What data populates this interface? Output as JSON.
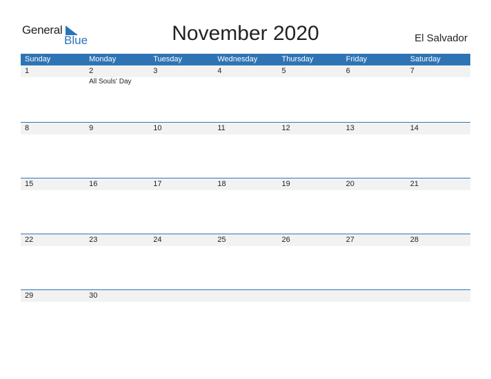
{
  "logo": {
    "general": "General",
    "blue": "Blue"
  },
  "title": "November 2020",
  "country": "El Salvador",
  "weekdays": [
    "Sunday",
    "Monday",
    "Tuesday",
    "Wednesday",
    "Thursday",
    "Friday",
    "Saturday"
  ],
  "weeks": [
    {
      "days": [
        "1",
        "2",
        "3",
        "4",
        "5",
        "6",
        "7"
      ],
      "events": [
        "",
        "All Souls' Day",
        "",
        "",
        "",
        "",
        ""
      ]
    },
    {
      "days": [
        "8",
        "9",
        "10",
        "11",
        "12",
        "13",
        "14"
      ],
      "events": [
        "",
        "",
        "",
        "",
        "",
        "",
        ""
      ]
    },
    {
      "days": [
        "15",
        "16",
        "17",
        "18",
        "19",
        "20",
        "21"
      ],
      "events": [
        "",
        "",
        "",
        "",
        "",
        "",
        ""
      ]
    },
    {
      "days": [
        "22",
        "23",
        "24",
        "25",
        "26",
        "27",
        "28"
      ],
      "events": [
        "",
        "",
        "",
        "",
        "",
        "",
        ""
      ]
    },
    {
      "days": [
        "29",
        "30",
        "",
        "",
        "",
        "",
        ""
      ],
      "events": [
        "",
        "",
        "",
        "",
        "",
        "",
        ""
      ]
    }
  ],
  "colors": {
    "accent": "#2e74b5",
    "row_bg": "#f2f2f2"
  }
}
